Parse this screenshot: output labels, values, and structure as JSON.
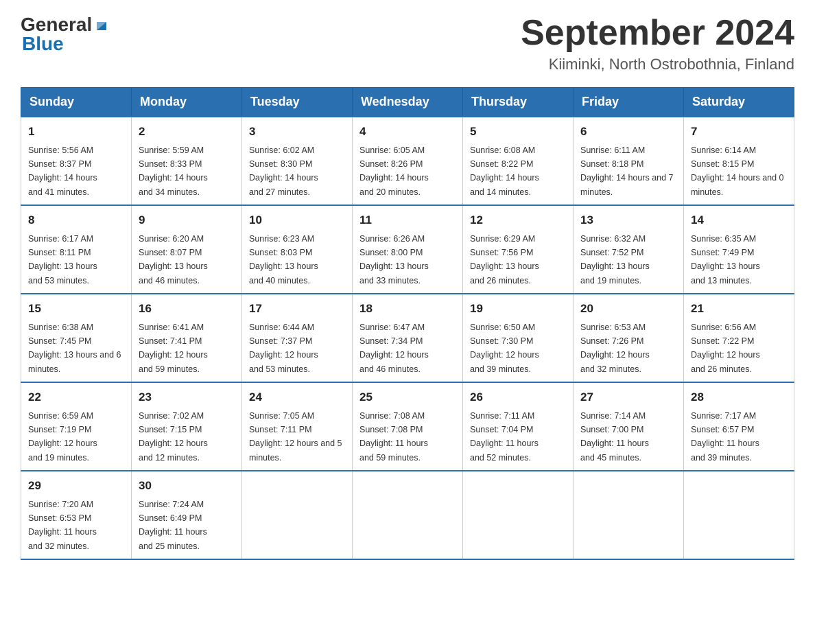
{
  "header": {
    "logo": {
      "text_general": "General",
      "text_blue": "Blue",
      "triangle_symbol": "▶"
    },
    "month_title": "September 2024",
    "location": "Kiiminki, North Ostrobothnia, Finland"
  },
  "weekdays": [
    "Sunday",
    "Monday",
    "Tuesday",
    "Wednesday",
    "Thursday",
    "Friday",
    "Saturday"
  ],
  "weeks": [
    [
      {
        "day": "1",
        "sunrise": "5:56 AM",
        "sunset": "8:37 PM",
        "daylight": "14 hours and 41 minutes."
      },
      {
        "day": "2",
        "sunrise": "5:59 AM",
        "sunset": "8:33 PM",
        "daylight": "14 hours and 34 minutes."
      },
      {
        "day": "3",
        "sunrise": "6:02 AM",
        "sunset": "8:30 PM",
        "daylight": "14 hours and 27 minutes."
      },
      {
        "day": "4",
        "sunrise": "6:05 AM",
        "sunset": "8:26 PM",
        "daylight": "14 hours and 20 minutes."
      },
      {
        "day": "5",
        "sunrise": "6:08 AM",
        "sunset": "8:22 PM",
        "daylight": "14 hours and 14 minutes."
      },
      {
        "day": "6",
        "sunrise": "6:11 AM",
        "sunset": "8:18 PM",
        "daylight": "14 hours and 7 minutes."
      },
      {
        "day": "7",
        "sunrise": "6:14 AM",
        "sunset": "8:15 PM",
        "daylight": "14 hours and 0 minutes."
      }
    ],
    [
      {
        "day": "8",
        "sunrise": "6:17 AM",
        "sunset": "8:11 PM",
        "daylight": "13 hours and 53 minutes."
      },
      {
        "day": "9",
        "sunrise": "6:20 AM",
        "sunset": "8:07 PM",
        "daylight": "13 hours and 46 minutes."
      },
      {
        "day": "10",
        "sunrise": "6:23 AM",
        "sunset": "8:03 PM",
        "daylight": "13 hours and 40 minutes."
      },
      {
        "day": "11",
        "sunrise": "6:26 AM",
        "sunset": "8:00 PM",
        "daylight": "13 hours and 33 minutes."
      },
      {
        "day": "12",
        "sunrise": "6:29 AM",
        "sunset": "7:56 PM",
        "daylight": "13 hours and 26 minutes."
      },
      {
        "day": "13",
        "sunrise": "6:32 AM",
        "sunset": "7:52 PM",
        "daylight": "13 hours and 19 minutes."
      },
      {
        "day": "14",
        "sunrise": "6:35 AM",
        "sunset": "7:49 PM",
        "daylight": "13 hours and 13 minutes."
      }
    ],
    [
      {
        "day": "15",
        "sunrise": "6:38 AM",
        "sunset": "7:45 PM",
        "daylight": "13 hours and 6 minutes."
      },
      {
        "day": "16",
        "sunrise": "6:41 AM",
        "sunset": "7:41 PM",
        "daylight": "12 hours and 59 minutes."
      },
      {
        "day": "17",
        "sunrise": "6:44 AM",
        "sunset": "7:37 PM",
        "daylight": "12 hours and 53 minutes."
      },
      {
        "day": "18",
        "sunrise": "6:47 AM",
        "sunset": "7:34 PM",
        "daylight": "12 hours and 46 minutes."
      },
      {
        "day": "19",
        "sunrise": "6:50 AM",
        "sunset": "7:30 PM",
        "daylight": "12 hours and 39 minutes."
      },
      {
        "day": "20",
        "sunrise": "6:53 AM",
        "sunset": "7:26 PM",
        "daylight": "12 hours and 32 minutes."
      },
      {
        "day": "21",
        "sunrise": "6:56 AM",
        "sunset": "7:22 PM",
        "daylight": "12 hours and 26 minutes."
      }
    ],
    [
      {
        "day": "22",
        "sunrise": "6:59 AM",
        "sunset": "7:19 PM",
        "daylight": "12 hours and 19 minutes."
      },
      {
        "day": "23",
        "sunrise": "7:02 AM",
        "sunset": "7:15 PM",
        "daylight": "12 hours and 12 minutes."
      },
      {
        "day": "24",
        "sunrise": "7:05 AM",
        "sunset": "7:11 PM",
        "daylight": "12 hours and 5 minutes."
      },
      {
        "day": "25",
        "sunrise": "7:08 AM",
        "sunset": "7:08 PM",
        "daylight": "11 hours and 59 minutes."
      },
      {
        "day": "26",
        "sunrise": "7:11 AM",
        "sunset": "7:04 PM",
        "daylight": "11 hours and 52 minutes."
      },
      {
        "day": "27",
        "sunrise": "7:14 AM",
        "sunset": "7:00 PM",
        "daylight": "11 hours and 45 minutes."
      },
      {
        "day": "28",
        "sunrise": "7:17 AM",
        "sunset": "6:57 PM",
        "daylight": "11 hours and 39 minutes."
      }
    ],
    [
      {
        "day": "29",
        "sunrise": "7:20 AM",
        "sunset": "6:53 PM",
        "daylight": "11 hours and 32 minutes."
      },
      {
        "day": "30",
        "sunrise": "7:24 AM",
        "sunset": "6:49 PM",
        "daylight": "11 hours and 25 minutes."
      },
      null,
      null,
      null,
      null,
      null
    ]
  ],
  "labels": {
    "sunrise": "Sunrise:",
    "sunset": "Sunset:",
    "daylight": "Daylight:"
  }
}
